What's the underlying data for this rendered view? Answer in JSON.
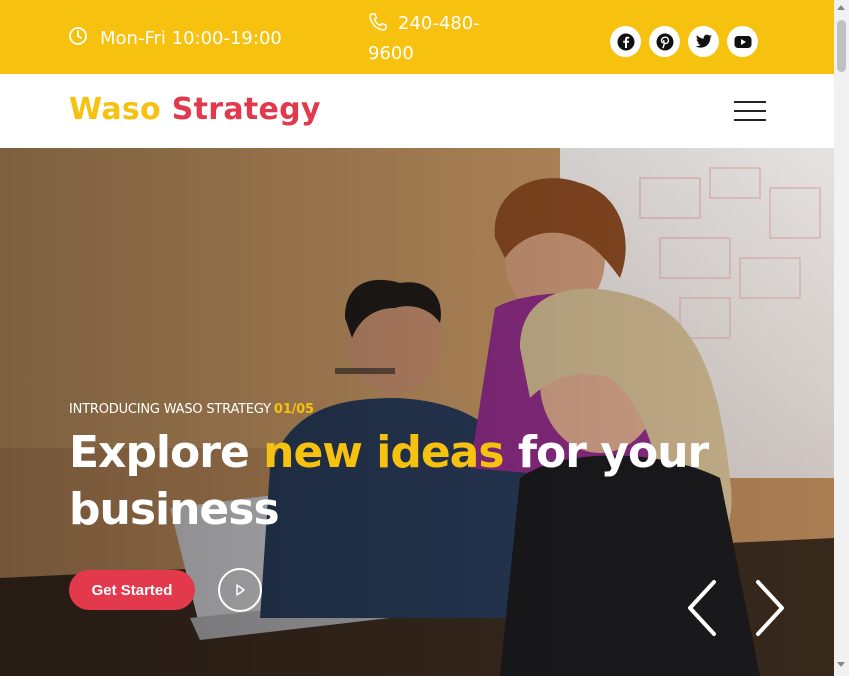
{
  "topbar": {
    "hours_text": "Mon-Fri 10:00-19:00",
    "hours_icon": "clock-icon",
    "phone_text": "240-480-9600",
    "phone_icon": "phone-icon",
    "socials": [
      {
        "name": "facebook-icon"
      },
      {
        "name": "pinterest-icon"
      },
      {
        "name": "twitter-icon"
      },
      {
        "name": "youtube-icon"
      }
    ],
    "background": "#F7C10F"
  },
  "header": {
    "logo_part1": "Waso",
    "logo_part2": "Strategy",
    "menu_icon": "hamburger-menu-icon"
  },
  "hero": {
    "kicker": "INTRODUCING WASO STRATEGY",
    "slide_counter": "01/05",
    "headline_part1": "Explore",
    "headline_highlight": "new ideas",
    "headline_part2": "for your business",
    "cta_label": "Get Started",
    "play_icon": "play-icon",
    "prev_icon": "chevron-left-icon",
    "next_icon": "chevron-right-icon"
  },
  "colors": {
    "accent_yellow": "#F7C10F",
    "accent_red": "#E23A4C"
  }
}
